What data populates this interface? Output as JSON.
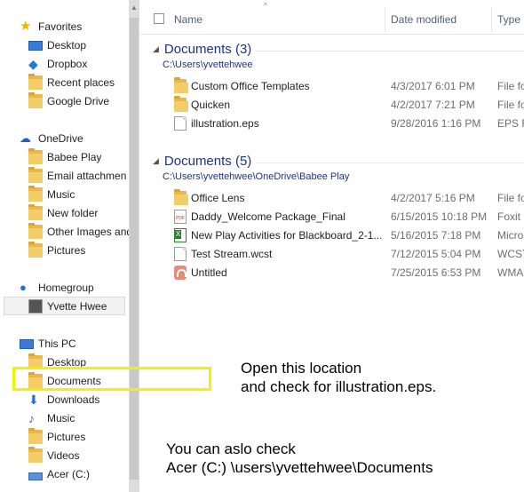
{
  "nav": {
    "favorites": "Favorites",
    "desktop_fav": "Desktop",
    "dropbox": "Dropbox",
    "recent_places": "Recent places",
    "google_drive": "Google Drive",
    "onedrive": "OneDrive",
    "onedrive_items": [
      "Babee Play",
      "Email attachmen",
      "Music",
      "New folder",
      "Other Images and",
      "Pictures"
    ],
    "homegroup": "Homegroup",
    "homegroup_user": "Yvette Hwee",
    "this_pc": "This PC",
    "this_pc_items": [
      "Desktop",
      "Documents",
      "Downloads",
      "Music",
      "Pictures",
      "Videos",
      "Acer (C:)"
    ]
  },
  "columns": {
    "name": "Name",
    "date": "Date modified",
    "type": "Type"
  },
  "groups": [
    {
      "title": "Documents (3)",
      "path": "C:\\Users\\yvettehwee",
      "files": [
        {
          "name": "Custom Office Templates",
          "date": "4/3/2017 6:01 PM",
          "type": "File fo",
          "icon": "folder-icon"
        },
        {
          "name": "Quicken",
          "date": "4/2/2017 7:21 PM",
          "type": "File fo",
          "icon": "folder-icon"
        },
        {
          "name": "illustration.eps",
          "date": "9/28/2016 1:16 PM",
          "type": "EPS Fi",
          "icon": "document-icon"
        }
      ]
    },
    {
      "title": "Documents (5)",
      "path": "C:\\Users\\yvettehwee\\OneDrive\\Babee Play",
      "files": [
        {
          "name": "Office Lens",
          "date": "4/2/2017 5:16 PM",
          "type": "File fo",
          "icon": "folder-icon"
        },
        {
          "name": "Daddy_Welcome Package_Final",
          "date": "6/15/2015 10:18 PM",
          "type": "Foxit I",
          "icon": "pdf-icon"
        },
        {
          "name": "New Play Activities for Blackboard_2-1...",
          "date": "5/16/2015 7:18 PM",
          "type": "Micro",
          "icon": "excel-icon"
        },
        {
          "name": "Test Stream.wcst",
          "date": "7/12/2015 5:04 PM",
          "type": "WCST",
          "icon": "document-icon"
        },
        {
          "name": "Untitled",
          "date": "7/25/2015 6:53 PM",
          "type": "WMA",
          "icon": "audio-icon"
        }
      ]
    }
  ],
  "annotations": {
    "note1_line1": "Open this location",
    "note1_line2": "and check for illustration.eps.",
    "note2_line1": "You can aslo check",
    "note2_line2": "Acer (C:) \\users\\yvettehwee\\Documents",
    "highlight_color": "#f3f300"
  }
}
